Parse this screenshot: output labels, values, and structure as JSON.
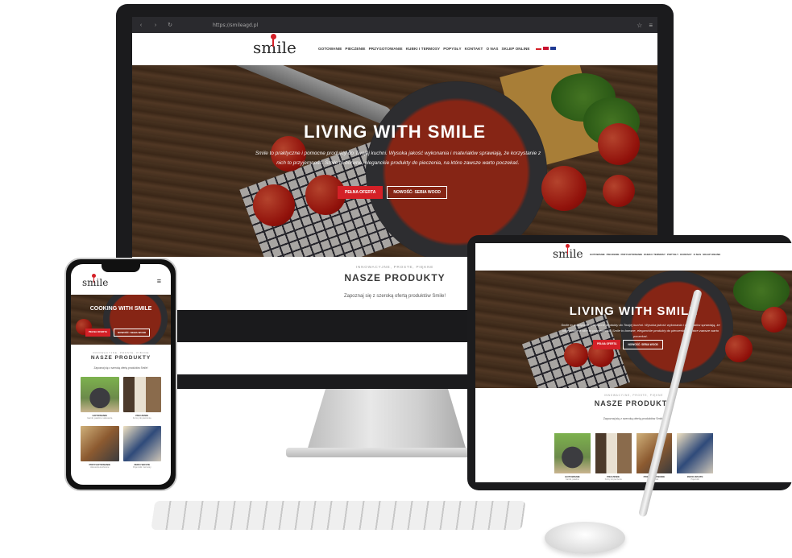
{
  "browser": {
    "url": "https://smileagd.pl"
  },
  "brand": {
    "logo_text": "smile",
    "accent_color": "#d42027"
  },
  "nav": {
    "items": [
      "GOTOWANIE",
      "PIECZENIE",
      "PRZYGOTOWANIE",
      "KUBKI I TERMOSY",
      "POPYSŁY",
      "KONTAKT",
      "O NAS",
      "SKLEP ONLINE"
    ],
    "flags": [
      "pl-flag",
      "uk-flag",
      "eu-flag"
    ]
  },
  "hero": {
    "title": "LIVING WITH SMILE",
    "text": "Smile to praktyczne i pomocne produkty do Twojej kuchni. Wysoka jakość wykonania i materiałów sprawiają, że korzystanie z nich to przyjemność. Smile to borwne, eleganckie produkty do pieczenia, na które zawsze warto poczekać.",
    "button_primary": "PEŁNA OFERTA",
    "button_secondary": "NOWOŚĆ: SEBIA WOOD"
  },
  "products": {
    "kicker": "INNOWACYJNE, PROSTE, PIĘKNE",
    "title": "NASZE PRODUKTY",
    "subtitle": "Zapoznaj się z szeroką ofertą produktów Smile!"
  },
  "phone": {
    "hero_title": "COOKING WITH SMILE",
    "menu_icon": "hamburger-icon",
    "cards": [
      {
        "title": "GOTOWANIE",
        "sub": "Garnki, patelnie i akcesoria"
      },
      {
        "title": "PIECZENIE",
        "sub": "Formy do pieczenia"
      },
      {
        "title": "PRZYGOTOWANIE",
        "sub": "Akcesoria kuchenne"
      },
      {
        "title": "ZERO WASTE",
        "sub": "Pojemniki i termosy"
      }
    ]
  },
  "tablet": {
    "cards": [
      {
        "title": "GOTOWANIE",
        "sub": "Garnki, patelnie"
      },
      {
        "title": "PIECZENIE",
        "sub": "Formy do pieczenia"
      },
      {
        "title": "PRZYGOTOWANIE",
        "sub": "Akcesoria"
      },
      {
        "title": "ZERO WASTE",
        "sub": "Pojemniki"
      }
    ]
  }
}
